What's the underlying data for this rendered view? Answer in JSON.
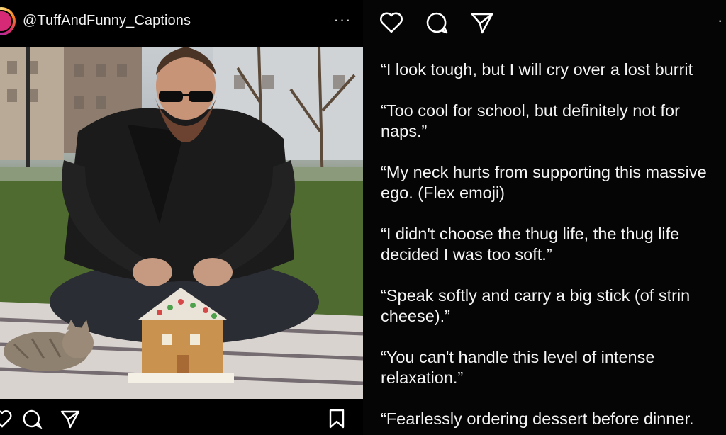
{
  "post": {
    "username": "@TuffAndFunny_Captions",
    "more_label": "···",
    "image_icon": "photo-of-bearded-man-building-gingerbread-house-with-kitten",
    "actions": [
      "like-icon",
      "comment-icon",
      "share-icon",
      "save-icon"
    ]
  },
  "captions_panel": {
    "actions": [
      "heart-icon",
      "comment-icon",
      "send-icon"
    ],
    "more_label": "·",
    "items": [
      "“I look tough, but I will cry over a lost burrit",
      "“Too cool for school, but definitely not for naps.”",
      "“My neck hurts from supporting this massive ego. (Flex emoji)",
      "“I didn't choose the thug life, the thug life decided I was too soft.”",
      "“Speak softly and carry a big stick (of strin cheese).”",
      "“You can't handle this level of intense relaxation.”",
      "“Fearlessly ordering dessert before dinner."
    ]
  },
  "colors": {
    "background": "#000000",
    "text": "#f4f4f4",
    "avatar_ring": "#d62976"
  }
}
